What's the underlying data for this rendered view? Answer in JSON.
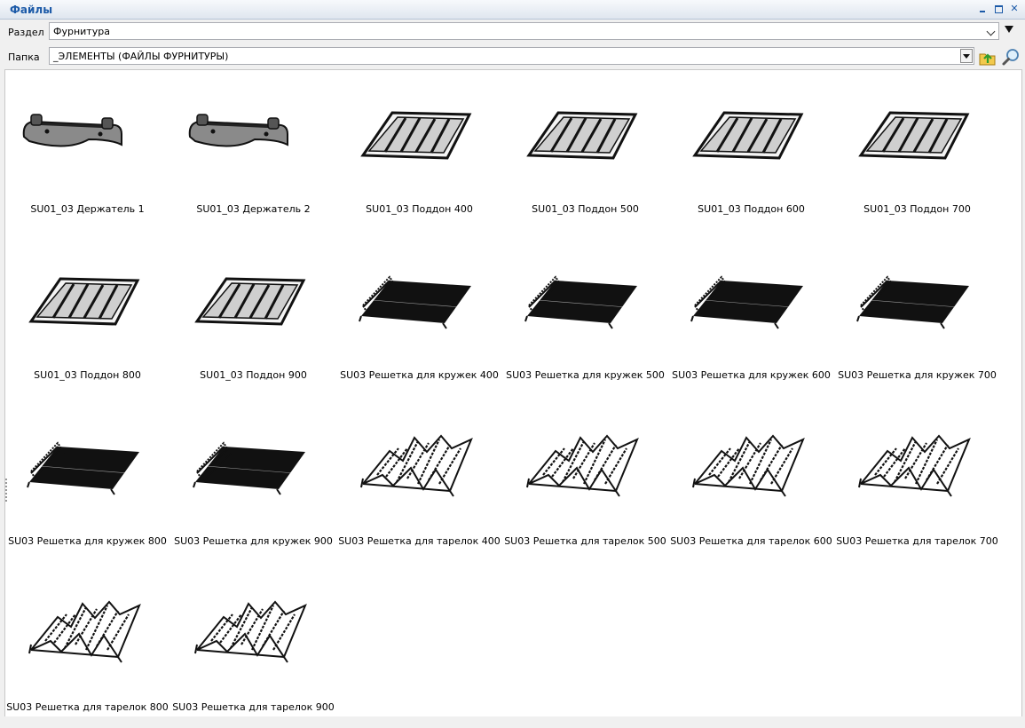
{
  "window": {
    "title": "Файлы"
  },
  "section": {
    "label": "Раздел",
    "value": "Фурнитура"
  },
  "folder": {
    "label": "Папка",
    "value": "_ЭЛЕМЕНТЫ (ФАЙЛЫ ФУРНИТУРЫ)"
  },
  "items": [
    {
      "label": "SU01_03 Держатель 1",
      "icon": "holder-icon"
    },
    {
      "label": "SU01_03 Держатель 2",
      "icon": "holder-icon"
    },
    {
      "label": "SU01_03 Поддон 400",
      "icon": "tray-icon"
    },
    {
      "label": "SU01_03 Поддон 500",
      "icon": "tray-icon"
    },
    {
      "label": "SU01_03 Поддон 600",
      "icon": "tray-icon"
    },
    {
      "label": "SU01_03 Поддон 700",
      "icon": "tray-icon"
    },
    {
      "label": "SU01_03 Поддон 800",
      "icon": "tray-icon"
    },
    {
      "label": "SU01_03 Поддон 900",
      "icon": "tray-icon"
    },
    {
      "label": "SU03 Решетка для кружек 400",
      "icon": "cup-rack-icon"
    },
    {
      "label": "SU03 Решетка для кружек 500",
      "icon": "cup-rack-icon"
    },
    {
      "label": "SU03 Решетка для кружек 600",
      "icon": "cup-rack-icon"
    },
    {
      "label": "SU03 Решетка для кружек 700",
      "icon": "cup-rack-icon"
    },
    {
      "label": "SU03 Решетка для кружек 800",
      "icon": "cup-rack-icon"
    },
    {
      "label": "SU03 Решетка для кружек 900",
      "icon": "cup-rack-icon"
    },
    {
      "label": "SU03 Решетка для тарелок 400",
      "icon": "plate-rack-icon"
    },
    {
      "label": "SU03 Решетка для тарелок 500",
      "icon": "plate-rack-icon"
    },
    {
      "label": "SU03 Решетка для тарелок 600",
      "icon": "plate-rack-icon"
    },
    {
      "label": "SU03 Решетка для тарелок 700",
      "icon": "plate-rack-icon"
    },
    {
      "label": "SU03 Решетка для тарелок 800",
      "icon": "plate-rack-icon"
    },
    {
      "label": "SU03 Решетка для тарелок 900",
      "icon": "plate-rack-icon"
    }
  ]
}
